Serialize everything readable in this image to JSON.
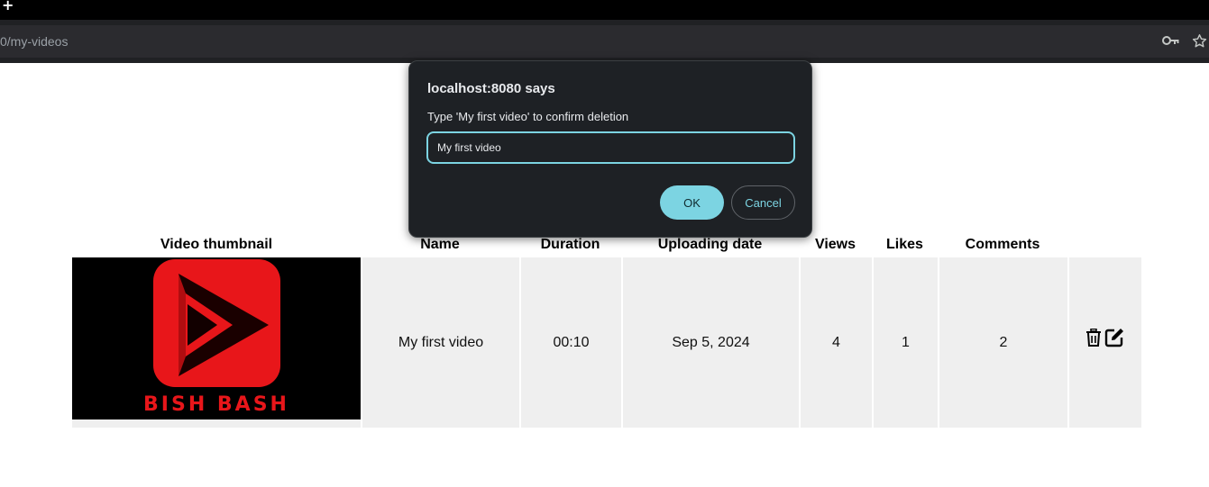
{
  "browser": {
    "new_tab_icon": "plus-icon",
    "url": "0/my-videos",
    "password_icon": "key-icon",
    "bookmark_icon": "star-icon"
  },
  "table": {
    "headers": [
      "Video thumbnail",
      "Name",
      "Duration",
      "Uploading date",
      "Views",
      "Likes",
      "Comments",
      ""
    ],
    "rows": [
      {
        "thumbnail_brand": "BISH BASH",
        "name": "My first video",
        "duration": "00:10",
        "upload_date": "Sep 5, 2024",
        "views": "4",
        "likes": "1",
        "comments": "2",
        "actions": [
          "trash-icon",
          "edit-icon"
        ]
      }
    ]
  },
  "dialog": {
    "title": "localhost:8080 says",
    "message": "Type 'My first video' to confirm deletion",
    "input_value": "My first video",
    "ok_label": "OK",
    "cancel_label": "Cancel",
    "accent_color": "#7cd4e2"
  },
  "colors": {
    "brand_red": "#e8161a",
    "cell_bg": "#efefef",
    "dialog_bg": "#1e2125"
  }
}
